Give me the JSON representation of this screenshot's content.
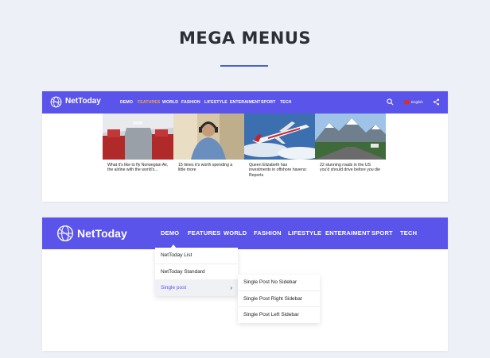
{
  "heading": "MEGA MENUS",
  "colors": {
    "nav": "#5b54ea",
    "accent": "#f5a43c",
    "rule": "#4a63c9"
  },
  "panel1": {
    "logo": "NetToday",
    "menu": [
      "DEMO",
      "FEATURES",
      "WORLD",
      "FASHION",
      "LIFESTYLE",
      "ENTERAIMENT",
      "SPORT",
      "TECH"
    ],
    "active_item": "FEATURES",
    "language": "English",
    "icons": [
      "search-icon",
      "flag-icon",
      "share-icon"
    ],
    "cards": [
      {
        "caption": "What it's like to fly Norwegian Air, the airline with the world's..."
      },
      {
        "caption": "15 times it's worth spending a little more"
      },
      {
        "caption": "Queen Elizabeth has investments in offshore havens: Reports"
      },
      {
        "caption": "22 stunning roads in the US you'd should drive before you die"
      }
    ]
  },
  "panel2": {
    "logo": "NetToday",
    "menu": [
      "DEMO",
      "FEATURES",
      "WORLD",
      "FASHION",
      "LIFESTYLE",
      "ENTERAIMENT",
      "SPORT",
      "TECH"
    ],
    "dropdown": [
      "NetToday List",
      "NetToday Standard",
      "Single post"
    ],
    "submenu": [
      "Single Post No Sidebar",
      "Single Post Right Sidebar",
      "Single Post Left Sidebar"
    ]
  }
}
